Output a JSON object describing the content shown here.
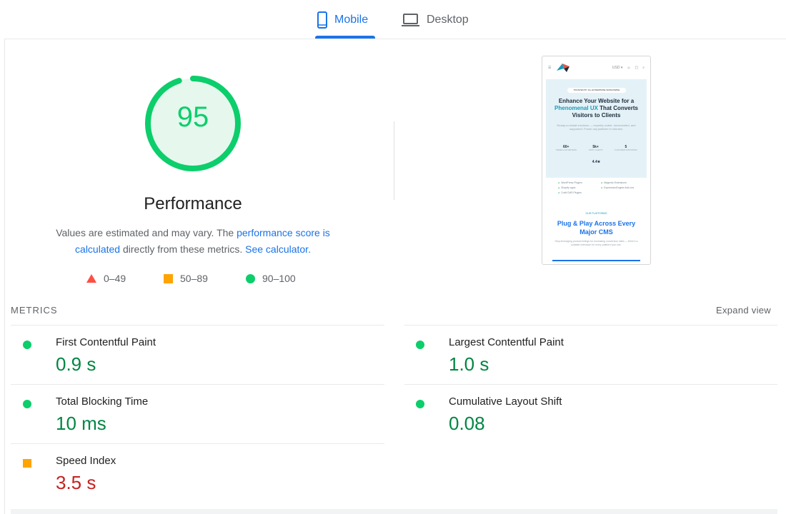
{
  "tabs": {
    "mobile_label": "Mobile",
    "desktop_label": "Desktop",
    "active": "Mobile"
  },
  "score": {
    "value": "95",
    "fraction": 0.95,
    "title": "Performance",
    "desc_prefix": "Values are estimated and may vary. The ",
    "desc_link1": "performance score is calculated",
    "desc_middle": " directly from these metrics. ",
    "desc_link2": "See calculator."
  },
  "legend": {
    "poor": "0–49",
    "average": "50–89",
    "good": "90–100"
  },
  "thumbnail": {
    "currency": "USD ▾",
    "badge": "TRUSTED BY 10+ ENTERPRISE WORLDWIDE",
    "heading_1": "Enhance Your Website for a",
    "heading_highlight": "Phenomenal UX",
    "heading_2": "That Converts Visitors to Clients",
    "subtext": "Ready-to-install solutions — expertly coded, documented, and supported. Power any platform in minutes.",
    "stats": [
      {
        "value": "60+",
        "label": "THEMES & EXTENSIONS"
      },
      {
        "value": "5k+",
        "label": "HAPPY CLIENTS"
      },
      {
        "value": "5",
        "label": "PLATFORMS SUPPORTED"
      }
    ],
    "rating": "4.4★",
    "list": [
      "WordPress Plugins",
      "Magento Extensions",
      "Shopify apps",
      "ExpressionEngine Add-ons",
      "Craft CMS Plugins"
    ],
    "small_label": "OUR PLATFORMS",
    "heading2": "Plug & Play Across Every Major CMS",
    "subtext2": "Stop leveraging product listings for increasing conversion rates — there's a suitable extension for every platform you use."
  },
  "metrics": {
    "section_label": "METRICS",
    "expand_label": "Expand view",
    "items": [
      {
        "name": "First Contentful Paint",
        "value": "0.9 s",
        "status": "good"
      },
      {
        "name": "Largest Contentful Paint",
        "value": "1.0 s",
        "status": "good"
      },
      {
        "name": "Total Blocking Time",
        "value": "10 ms",
        "status": "good"
      },
      {
        "name": "Cumulative Layout Shift",
        "value": "0.08",
        "status": "good"
      },
      {
        "name": "Speed Index",
        "value": "3.5 s",
        "status": "average"
      }
    ]
  },
  "colors": {
    "accent": "#1a73e8",
    "good": "#0cce6b",
    "good_text": "#018642",
    "average": "#ffa400",
    "poor": "#ff4e42",
    "poor_text": "#c5221f"
  }
}
